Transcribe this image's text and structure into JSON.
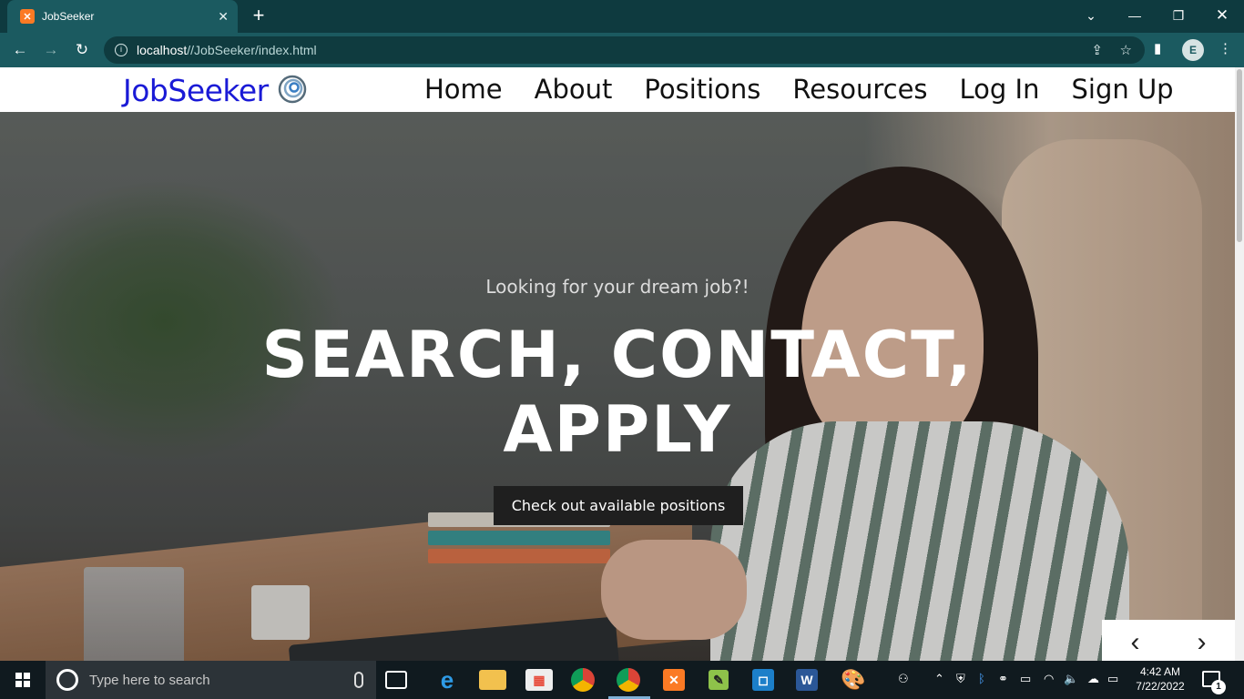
{
  "browser": {
    "tab_title": "JobSeeker",
    "tab_favicon": "xampp-icon",
    "url_host": "localhost",
    "url_path": "//JobSeeker/index.html",
    "profile_initial": "E"
  },
  "site": {
    "brand": "JobSeeker",
    "nav": [
      "Home",
      "About",
      "Positions",
      "Resources",
      "Log In",
      "Sign Up"
    ]
  },
  "hero": {
    "subtitle": "Looking for your dream job?!",
    "title_line1": "SEARCH, CONTACT,",
    "title_line2": "APPLY",
    "cta": "Check out available positions",
    "prev": "‹",
    "next": "›"
  },
  "taskbar": {
    "search_placeholder": "Type here to search",
    "time": "4:42 AM",
    "date": "7/22/2022",
    "notifications": "1",
    "pinned": [
      "task-view-icon",
      "edge-icon",
      "file-explorer-icon",
      "store-icon",
      "chrome-icon",
      "chrome-profile-icon",
      "xampp-icon",
      "notepadpp-icon",
      "vscode-icon",
      "word-icon",
      "paint-icon"
    ]
  }
}
